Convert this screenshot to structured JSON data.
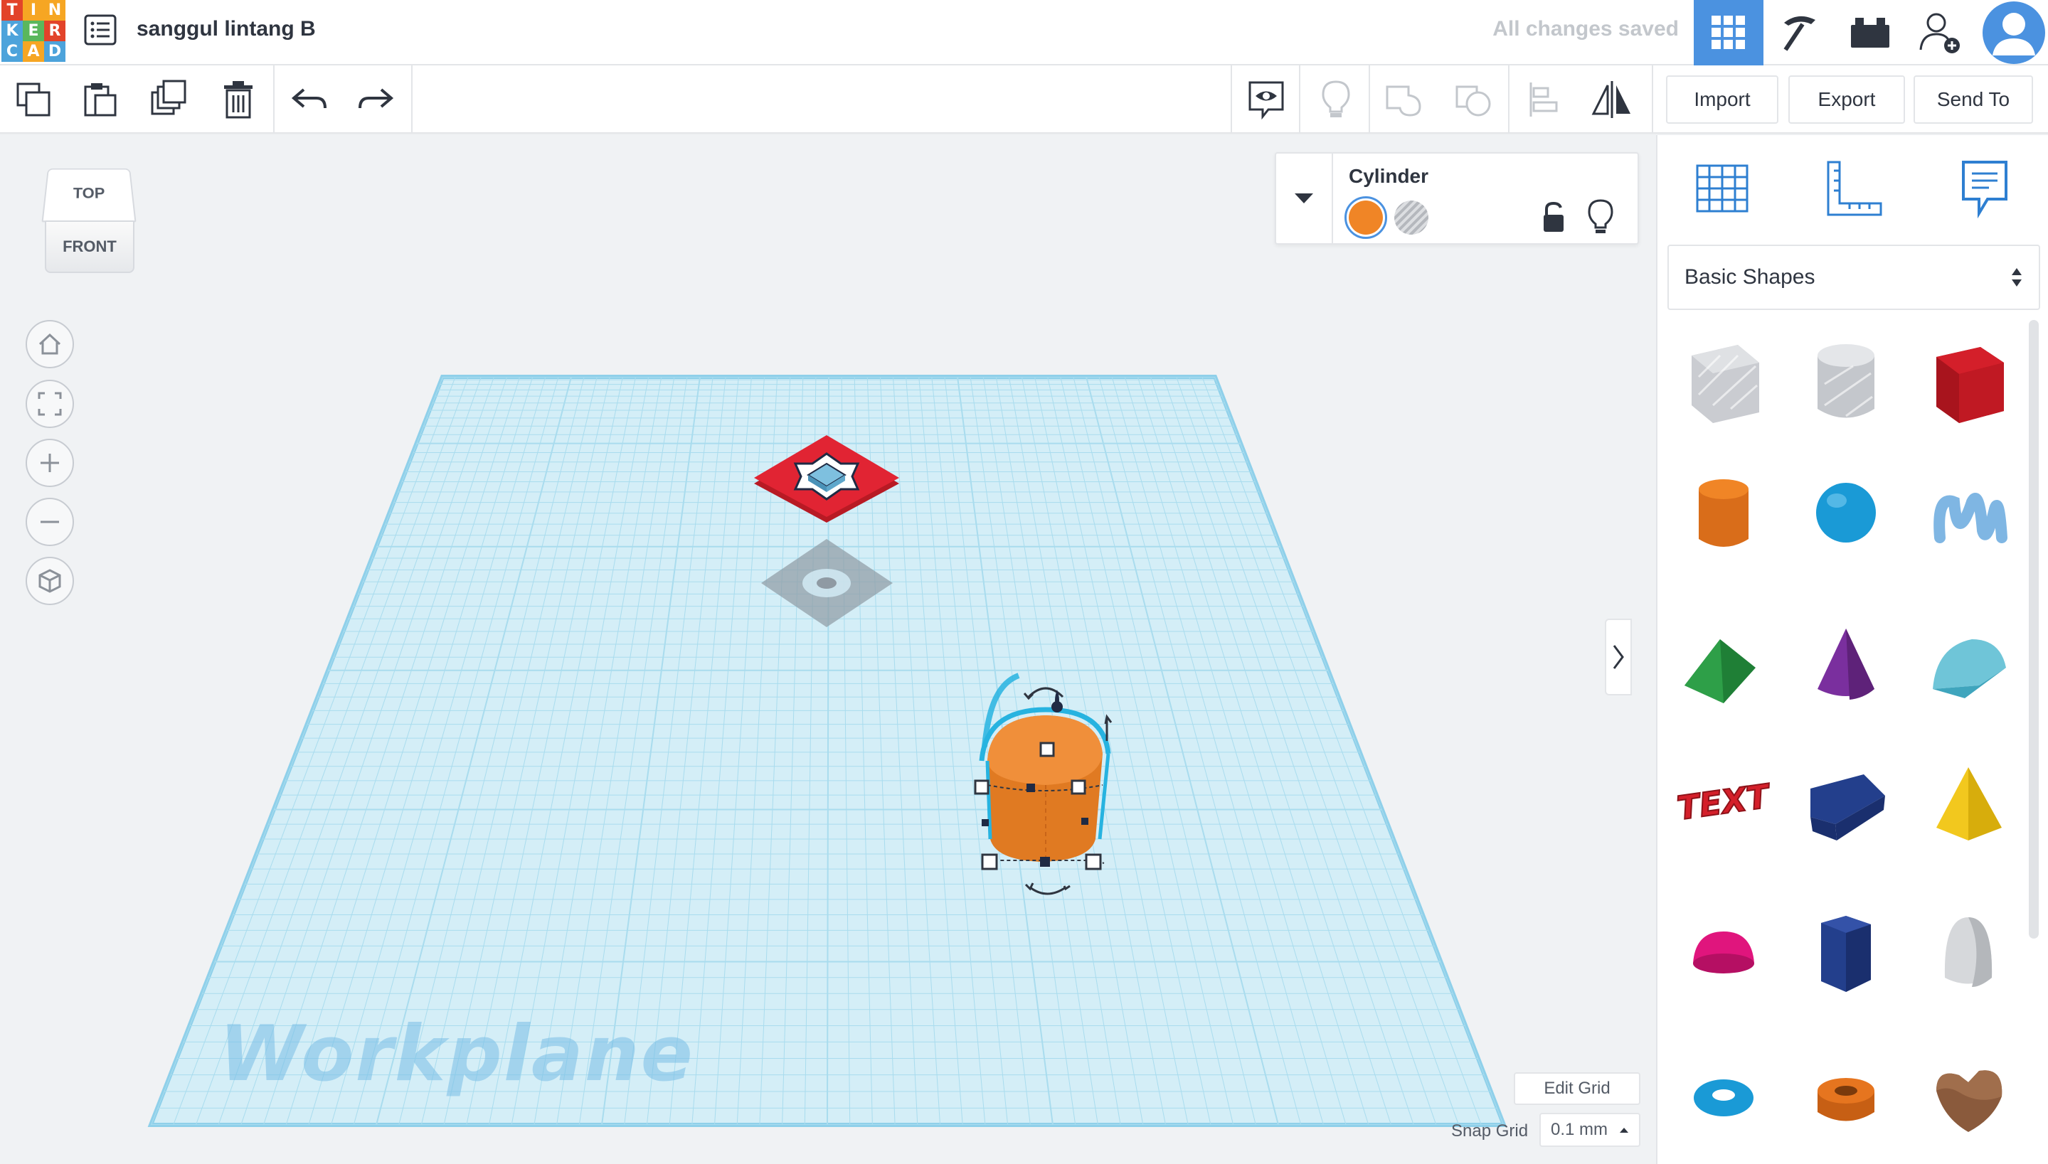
{
  "app": {
    "logo_letters": [
      "T",
      "I",
      "N",
      "K",
      "E",
      "R",
      "C",
      "A",
      "D"
    ],
    "logo_colors": [
      "#e2432a",
      "#f6a623",
      "#f6a623",
      "#4da3db",
      "#5ab75c",
      "#e2432a",
      "#4da3db",
      "#f6a623",
      "#4da3db"
    ],
    "document_title": "sanggul lintang B",
    "save_status": "All changes saved",
    "accent_color": "#4b92e0"
  },
  "toolbar": {
    "tools": [
      "copy-icon",
      "paste-icon",
      "duplicate-icon",
      "delete-icon",
      "undo-icon",
      "redo-icon"
    ],
    "right_tools": [
      "notes-eye-icon",
      "bulb-icon",
      "group-icon",
      "ungroup-icon",
      "align-icon",
      "mirror-icon"
    ],
    "import_label": "Import",
    "export_label": "Export",
    "send_to_label": "Send To"
  },
  "viewcube": {
    "top_label": "TOP",
    "front_label": "FRONT"
  },
  "nav_buttons": [
    "home-icon",
    "fit-view-icon",
    "zoom-in-icon",
    "zoom-out-icon",
    "perspective-icon"
  ],
  "workplane": {
    "label": "Workplane",
    "grid_color": "#a9dcee",
    "edit_grid_label": "Edit Grid",
    "snap_grid_label": "Snap Grid",
    "snap_grid_value": "0.1 mm"
  },
  "inspector": {
    "shape_name": "Cylinder",
    "solid_color": "#f08526"
  },
  "panel": {
    "tabs": [
      "workplane-grid-icon",
      "ruler-icon",
      "notes-icon"
    ],
    "library": "Basic Shapes",
    "shapes": [
      {
        "name": "Box hole",
        "color": "#c4c7cc"
      },
      {
        "name": "Cylinder hole",
        "color": "#c4c7cc"
      },
      {
        "name": "Box",
        "color": "#d41f2a"
      },
      {
        "name": "Cylinder",
        "color": "#f08526"
      },
      {
        "name": "Sphere",
        "color": "#1a9ad6"
      },
      {
        "name": "Scribble",
        "color": "#7fb6e3"
      },
      {
        "name": "Roof",
        "color": "#2e9f48"
      },
      {
        "name": "Cone",
        "color": "#7a2f9e"
      },
      {
        "name": "Round Roof",
        "color": "#6fc5d8"
      },
      {
        "name": "Text",
        "color": "#d41f2a"
      },
      {
        "name": "Wedge",
        "color": "#233f8c"
      },
      {
        "name": "Pyramid",
        "color": "#f2c81e"
      },
      {
        "name": "Half Sphere",
        "color": "#e0157d"
      },
      {
        "name": "Polygon",
        "color": "#233f8c"
      },
      {
        "name": "Paraboloid",
        "color": "#d6d8db"
      },
      {
        "name": "Torus",
        "color": "#1a9ad6"
      },
      {
        "name": "Tube",
        "color": "#e6751f"
      },
      {
        "name": "Heart",
        "color": "#8a5a3c"
      }
    ]
  }
}
